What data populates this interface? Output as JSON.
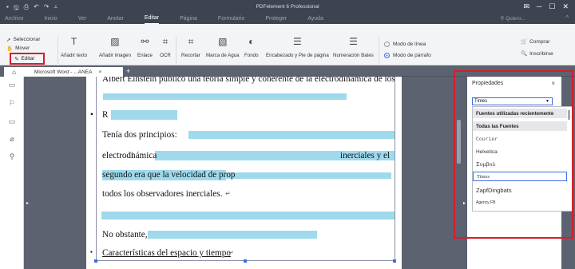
{
  "app": {
    "title": "PDFelement 6 Professional",
    "qat_icons": [
      "file-icon",
      "save-icon",
      "print-icon",
      "undo-icon",
      "redo-icon",
      "customize-icon"
    ],
    "window_controls": [
      "mail-icon",
      "minimize-icon",
      "maximize-icon",
      "close-icon"
    ]
  },
  "menu": {
    "items": [
      "Archivo",
      "Inicio",
      "Ver",
      "Anotar",
      "Editar",
      "Página",
      "Formulario",
      "Proteger",
      "Ayuda"
    ],
    "active": "Editar",
    "search_placeholder": "Quiero...",
    "collapse_symbol": "^"
  },
  "ribbon": {
    "select_label": "Seleccionar",
    "move_label": "Mover",
    "edit_label": "Editar",
    "tools": [
      "Añadir texto",
      "Añadir imagen",
      "Enlace",
      "OCR",
      "Recortar",
      "Marca de Agua",
      "Fondo",
      "Encabezado y Pie de página",
      "Numeración Bates"
    ],
    "mode_line": "Modo de línea",
    "mode_paragraph": "Modo de párrafo",
    "buy": "Comprar",
    "register": "Inscribirse"
  },
  "tabs": {
    "doc_tab": "Microsoft Word - ...ANEA",
    "close_symbol": "×",
    "add_symbol": "+"
  },
  "document": {
    "line1": "Albert Einstein publicó una teoría simple y coherente de la electrodinámica de los",
    "line3_start": "R",
    "line4_start": "Tenía dos principios:",
    "line5_start": "electrodi",
    "line5_hl": "námica",
    "line5_end": "inerciales y el",
    "line6_hl": "segundo era que la velocidad de prop",
    "line7": "todos los observadores inerciales.",
    "line9_start": "No obstante,",
    "line10": "Características del espacio y tiempo",
    "bullet": "•",
    "square_bullet": "▪",
    "para_mark": "↵"
  },
  "properties": {
    "title": "Propiedades",
    "close_symbol": "×",
    "font_value": "Times",
    "dropdown": [
      {
        "label": "Fuentes utilizadas recientemente",
        "type": "header"
      },
      {
        "label": "Todas las Fuentes",
        "type": "header"
      },
      {
        "label": "Courier",
        "type": "font"
      },
      {
        "label": "Helvetica",
        "type": "font"
      },
      {
        "label": "Συμβολ",
        "type": "font"
      },
      {
        "label": "Times",
        "type": "selected"
      },
      {
        "label": "ZapfDingbats",
        "type": "font"
      },
      {
        "label": "Agency FB",
        "type": "font"
      }
    ]
  }
}
